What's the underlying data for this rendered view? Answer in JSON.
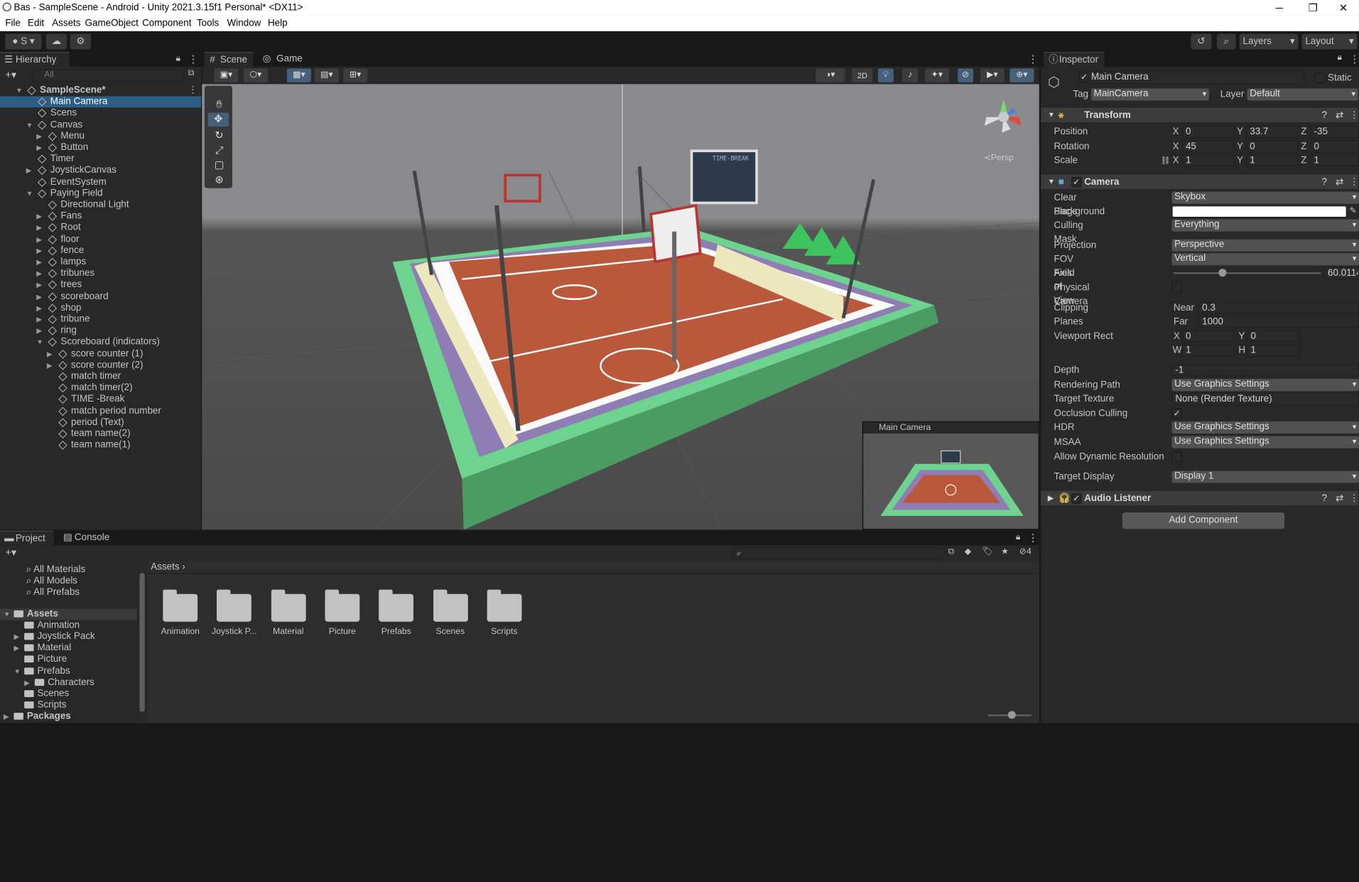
{
  "window": {
    "title": "Bas - SampleScene - Android - Unity 2021.3.15f1 Personal* <DX11>",
    "minimize": "─",
    "maximize": "❐",
    "close": "✕"
  },
  "menu": [
    "File",
    "Edit",
    "Assets",
    "GameObject",
    "Component",
    "Tools",
    "Window",
    "Help"
  ],
  "toolbar": {
    "account": "S",
    "layers": "Layers",
    "layout": "Layout"
  },
  "hierarchy": {
    "tab": "Hierarchy",
    "search_placeholder": "All",
    "items": [
      {
        "label": "SampleScene*",
        "indent": 0,
        "arrow": "▼",
        "icon": "unity-scene-icon",
        "bold": true
      },
      {
        "label": "Main Camera",
        "indent": 1,
        "selected": true
      },
      {
        "label": "Scens",
        "indent": 1
      },
      {
        "label": "Canvas",
        "indent": 1,
        "arrow": "▼"
      },
      {
        "label": "Menu",
        "indent": 2,
        "arrow": "▶"
      },
      {
        "label": "Button",
        "indent": 2,
        "arrow": "▶"
      },
      {
        "label": "Timer",
        "indent": 1
      },
      {
        "label": "JoystickCanvas",
        "indent": 1,
        "arrow": "▶"
      },
      {
        "label": "EventSystem",
        "indent": 1
      },
      {
        "label": "Paying Field",
        "indent": 1,
        "arrow": "▼"
      },
      {
        "label": "Directional Light",
        "indent": 2
      },
      {
        "label": "Fans",
        "indent": 2,
        "arrow": "▶"
      },
      {
        "label": "Root",
        "indent": 2,
        "arrow": "▶"
      },
      {
        "label": "floor",
        "indent": 2,
        "arrow": "▶"
      },
      {
        "label": "fence",
        "indent": 2,
        "arrow": "▶"
      },
      {
        "label": "lamps",
        "indent": 2,
        "arrow": "▶"
      },
      {
        "label": "tribunes",
        "indent": 2,
        "arrow": "▶"
      },
      {
        "label": "trees",
        "indent": 2,
        "arrow": "▶"
      },
      {
        "label": "scoreboard",
        "indent": 2,
        "arrow": "▶"
      },
      {
        "label": "shop",
        "indent": 2,
        "arrow": "▶"
      },
      {
        "label": "tribune",
        "indent": 2,
        "arrow": "▶"
      },
      {
        "label": "ring",
        "indent": 2,
        "arrow": "▶"
      },
      {
        "label": "Scoreboard (indicators)",
        "indent": 2,
        "arrow": "▼"
      },
      {
        "label": "score counter (1)",
        "indent": 3,
        "arrow": "▶"
      },
      {
        "label": "score counter (2)",
        "indent": 3,
        "arrow": "▶"
      },
      {
        "label": "match timer",
        "indent": 3
      },
      {
        "label": "match timer(2)",
        "indent": 3
      },
      {
        "label": "TIME -Break",
        "indent": 3
      },
      {
        "label": "match period number",
        "indent": 3
      },
      {
        "label": "period (Text)",
        "indent": 3
      },
      {
        "label": "team name(2)",
        "indent": 3
      },
      {
        "label": "team name(1)",
        "indent": 3
      }
    ]
  },
  "scene": {
    "tabs": [
      "Scene",
      "Game"
    ],
    "mode_2d": "2D",
    "persp": "≺Persp",
    "scoreboard": "TIME-BREAK",
    "preview_title": "Main Camera"
  },
  "inspector": {
    "tab": "Inspector",
    "object_name": "Main Camera",
    "static": "Static",
    "tag_label": "Tag",
    "tag": "MainCamera",
    "layer_label": "Layer",
    "layer": "Default",
    "transform": {
      "title": "Transform",
      "position": {
        "label": "Position",
        "x": "0",
        "y": "33.7",
        "z": "-35"
      },
      "rotation": {
        "label": "Rotation",
        "x": "45",
        "y": "0",
        "z": "0"
      },
      "scale": {
        "label": "Scale",
        "x": "1",
        "y": "1",
        "z": "1"
      }
    },
    "camera": {
      "title": "Camera",
      "clear_flags": [
        "Clear Flags",
        "Skybox"
      ],
      "background": "Background",
      "background_color": "#ffffff",
      "culling_mask": [
        "Culling Mask",
        "Everything"
      ],
      "projection": [
        "Projection",
        "Perspective"
      ],
      "fov_axis": [
        "FOV Axis",
        "Vertical"
      ],
      "fov": [
        "Field of View",
        "60.0114"
      ],
      "fov_fraction": 0.33,
      "physical_camera": "Physical Camera",
      "clipping": "Clipping Planes",
      "near": [
        "Near",
        "0.3"
      ],
      "far": [
        "Far",
        "1000"
      ],
      "viewport": "Viewport Rect",
      "vx": "0",
      "vy": "0",
      "vw": "1",
      "vh": "1",
      "depth": [
        "Depth",
        "-1"
      ],
      "rendering_path": [
        "Rendering Path",
        "Use Graphics Settings"
      ],
      "target_texture": [
        "Target Texture",
        "None (Render Texture)"
      ],
      "occlusion": "Occlusion Culling",
      "hdr": [
        "HDR",
        "Use Graphics Settings"
      ],
      "msaa": [
        "MSAA",
        "Use Graphics Settings"
      ],
      "dynres": "Allow Dynamic Resolution",
      "target_display": [
        "Target Display",
        "Display 1"
      ]
    },
    "audio": {
      "title": "Audio Listener"
    },
    "add_component": "Add Component"
  },
  "project": {
    "tabs": [
      "Project",
      "Console"
    ],
    "favorites": [
      "All Materials",
      "All Models",
      "All Prefabs"
    ],
    "tree": [
      {
        "label": "Assets",
        "indent": 0,
        "arrow": "▼",
        "bold": true
      },
      {
        "label": "Animation",
        "indent": 1
      },
      {
        "label": "Joystick Pack",
        "indent": 1,
        "arrow": "▶"
      },
      {
        "label": "Material",
        "indent": 1,
        "arrow": "▶"
      },
      {
        "label": "Picture",
        "indent": 1
      },
      {
        "label": "Prefabs",
        "indent": 1,
        "arrow": "▼"
      },
      {
        "label": "Characters",
        "indent": 2,
        "arrow": "▶"
      },
      {
        "label": "Scenes",
        "indent": 1
      },
      {
        "label": "Scripts",
        "indent": 1
      },
      {
        "label": "Packages",
        "indent": 0,
        "arrow": "▶",
        "bold": true
      }
    ],
    "breadcrumb": "Assets",
    "folders": [
      "Animation",
      "Joystick P...",
      "Material",
      "Picture",
      "Prefabs",
      "Scenes",
      "Scripts"
    ],
    "hidden_count": "4"
  },
  "colors": {
    "accent": "#2c5d87",
    "panel": "#282828",
    "dark": "#191919"
  }
}
